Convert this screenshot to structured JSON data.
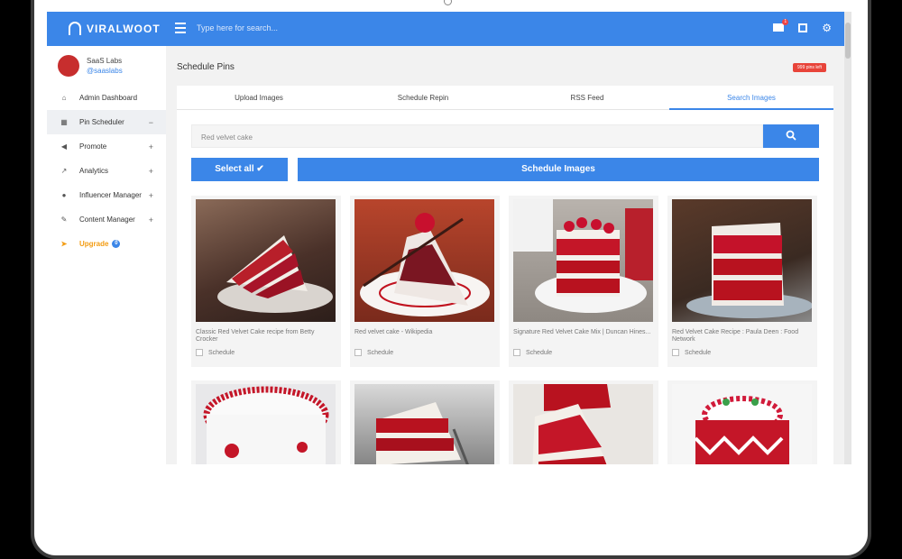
{
  "app": {
    "name": "VIRALWOOT",
    "search_placeholder": "Type here for search...",
    "mail_count": "1"
  },
  "profile": {
    "name": "SaaS Labs",
    "username": "@saaslabs"
  },
  "sidebar": {
    "items": [
      {
        "label": "Admin Dashboard",
        "icon": "home-icon",
        "sign": ""
      },
      {
        "label": "Pin Scheduler",
        "icon": "calendar-icon",
        "sign": "−"
      },
      {
        "label": "Promote",
        "icon": "megaphone-icon",
        "sign": "+"
      },
      {
        "label": "Analytics",
        "icon": "chart-icon",
        "sign": "+"
      },
      {
        "label": "Influencer Manager",
        "icon": "users-icon",
        "sign": "+"
      },
      {
        "label": "Content Manager",
        "icon": "edit-icon",
        "sign": "+"
      },
      {
        "label": "Upgrade",
        "icon": "rocket-icon",
        "sign": ""
      }
    ],
    "upgrade_badge": "0"
  },
  "page": {
    "title": "Schedule Pins",
    "pins_left": "999 pins left"
  },
  "tabs": [
    "Upload Images",
    "Schedule Repin",
    "RSS Feed",
    "Search Images"
  ],
  "search": {
    "value": "Red velvet cake"
  },
  "actions": {
    "select_all": "Select all ✔",
    "schedule_images": "Schedule Images"
  },
  "results": [
    {
      "caption": "Classic Red Velvet Cake recipe from Betty Crocker",
      "schedule_label": "Schedule"
    },
    {
      "caption": "Red velvet cake - Wikipedia",
      "schedule_label": "Schedule"
    },
    {
      "caption": "Signature Red Velvet Cake Mix | Duncan Hines...",
      "schedule_label": "Schedule"
    },
    {
      "caption": "Red Velvet Cake Recipe : Paula Deen : Food Network",
      "schedule_label": "Schedule"
    },
    {
      "caption": "",
      "schedule_label": ""
    },
    {
      "caption": "",
      "schedule_label": ""
    },
    {
      "caption": "",
      "schedule_label": ""
    },
    {
      "caption": "",
      "schedule_label": ""
    }
  ],
  "colors": {
    "primary": "#3b86e8",
    "badge_red": "#e8443a",
    "upgrade": "#f39c12"
  }
}
